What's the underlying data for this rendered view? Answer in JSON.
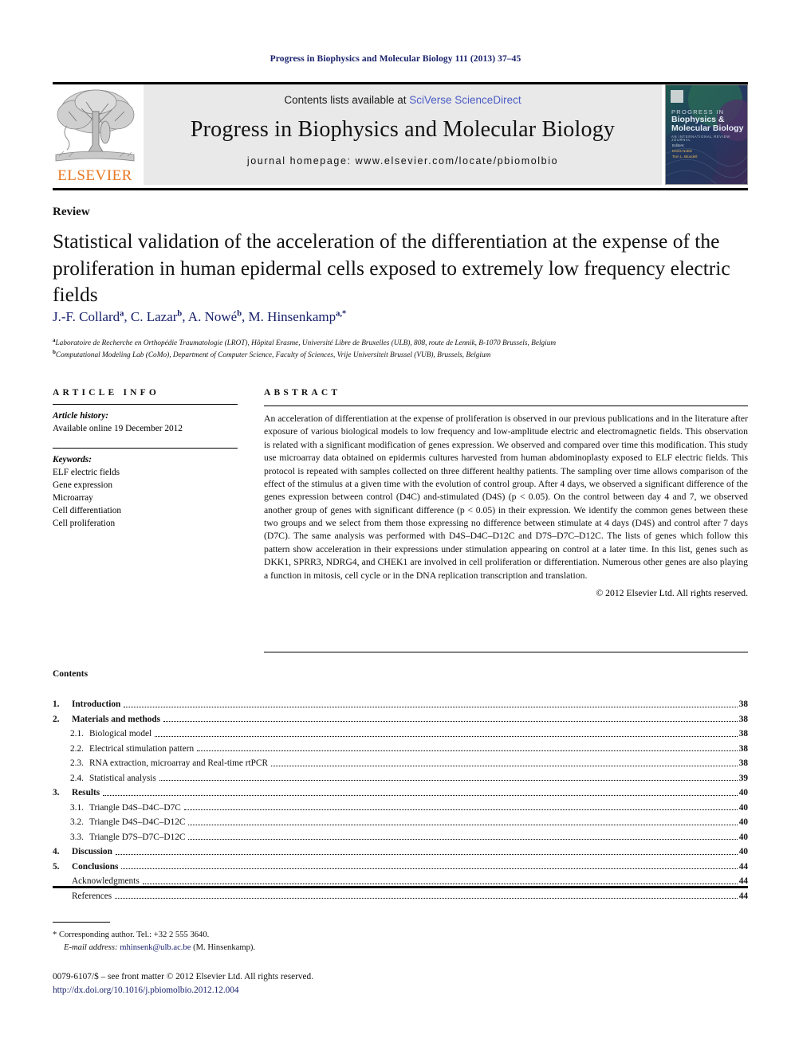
{
  "running_head": "Progress in Biophysics and Molecular Biology 111 (2013) 37–45",
  "masthead": {
    "publisher_name": "ELSEVIER",
    "contents_prefix": "Contents lists available at ",
    "sciencedirect": "SciVerse ScienceDirect",
    "journal_title": "Progress in Biophysics and Molecular Biology",
    "homepage": "journal homepage: www.elsevier.com/locate/pbiomolbio",
    "cover": {
      "line1": "PROGRESS IN",
      "line2": "Biophysics &",
      "line3": "Molecular Biology",
      "line4": "AN INTERNATIONAL REVIEW JOURNAL",
      "editors_label": "Editors:",
      "editor1": "Denis Noble",
      "editor2": "Tom L. Blundell"
    }
  },
  "article": {
    "type": "Review",
    "title": "Statistical validation of the acceleration of the differentiation at the expense of the proliferation in human epidermal cells exposed to extremely low frequency electric fields",
    "authors_html": "J.-F. Collard<sup>a</sup>, C. Lazar<sup>b</sup>, A. Nowé<sup>b</sup>, M. Hinsenkamp<sup>a,*</sup>",
    "affiliation_a": "Laboratoire de Recherche en Orthopédie Traumatologie (LROT), Hôpital Erasme, Université Libre de Bruxelles (ULB), 808, route de Lennik, B-1070 Brussels, Belgium",
    "affiliation_b": "Computational Modeling Lab (CoMo), Department of Computer Science, Faculty of Sciences, Vrije Universiteit Brussel (VUB), Brussels, Belgium"
  },
  "article_info": {
    "heading": "ARTICLE INFO",
    "history_label": "Article history:",
    "history_value": "Available online 19 December 2012",
    "keywords_label": "Keywords:",
    "keywords": [
      "ELF electric fields",
      "Gene expression",
      "Microarray",
      "Cell differentiation",
      "Cell proliferation"
    ]
  },
  "abstract": {
    "heading": "ABSTRACT",
    "text": "An acceleration of differentiation at the expense of proliferation is observed in our previous publications and in the literature after exposure of various biological models to low frequency and low-amplitude electric and electromagnetic fields. This observation is related with a significant modification of genes expression. We observed and compared over time this modification. This study use microarray data obtained on epidermis cultures harvested from human abdominoplasty exposed to ELF electric fields. This protocol is repeated with samples collected on three different healthy patients. The sampling over time allows comparison of the effect of the stimulus at a given time with the evolution of control group. After 4 days, we observed a significant difference of the genes expression between control (D4C) and-stimulated (D4S) (p < 0.05). On the control between day 4 and 7, we observed another group of genes with significant difference (p < 0.05) in their expression. We identify the common genes between these two groups and we select from them those expressing no difference between stimulate at 4 days (D4S) and control after 7 days (D7C). The same analysis was performed with D4S–D4C–D12C and D7S–D7C–D12C. The lists of genes which follow this pattern show acceleration in their expressions under stimulation appearing on control at a later time. In this list, genes such as DKK1, SPRR3, NDRG4, and CHEK1 are involved in cell proliferation or differentiation. Numerous other genes are also playing a function in mitosis, cell cycle or in the DNA replication transcription and translation.",
    "copyright": "© 2012 Elsevier Ltd. All rights reserved."
  },
  "contents": {
    "heading": "Contents",
    "rows": [
      {
        "num": "1.",
        "label": "Introduction",
        "page": "38",
        "sub": false
      },
      {
        "num": "2.",
        "label": "Materials and methods",
        "page": "38",
        "sub": false
      },
      {
        "num": "2.1.",
        "label": "Biological model",
        "page": "38",
        "sub": true
      },
      {
        "num": "2.2.",
        "label": "Electrical stimulation pattern",
        "page": "38",
        "sub": true
      },
      {
        "num": "2.3.",
        "label": "RNA extraction, microarray and Real-time rtPCR",
        "page": "38",
        "sub": true
      },
      {
        "num": "2.4.",
        "label": "Statistical analysis",
        "page": "39",
        "sub": true
      },
      {
        "num": "3.",
        "label": "Results",
        "page": "40",
        "sub": false
      },
      {
        "num": "3.1.",
        "label": "Triangle D4S–D4C–D7C",
        "page": "40",
        "sub": true
      },
      {
        "num": "3.2.",
        "label": "Triangle D4S–D4C–D12C",
        "page": "40",
        "sub": true
      },
      {
        "num": "3.3.",
        "label": "Triangle D7S–D7C–D12C",
        "page": "40",
        "sub": true
      },
      {
        "num": "4.",
        "label": "Discussion",
        "page": "40",
        "sub": false
      },
      {
        "num": "5.",
        "label": "Conclusions",
        "page": "44",
        "sub": false
      },
      {
        "num": "",
        "label": "Acknowledgments",
        "page": "44",
        "sub": true
      },
      {
        "num": "",
        "label": "References",
        "page": "44",
        "sub": true
      }
    ]
  },
  "footer": {
    "corresponding": "* Corresponding author. Tel.: +32 2 555 3640.",
    "email_label": "E-mail address:",
    "email": "mhinsenk@ulb.ac.be",
    "email_suffix": "(M. Hinsenkamp).",
    "issn_line": "0079-6107/$ – see front matter © 2012 Elsevier Ltd. All rights reserved.",
    "doi": "http://dx.doi.org/10.1016/j.pbiomolbio.2012.12.004"
  },
  "colors": {
    "navy": "#18216b",
    "elsevier_orange": "#E87722",
    "sciencedirect_blue": "#4a5bc4",
    "band_grey": "#e9e9e9"
  }
}
